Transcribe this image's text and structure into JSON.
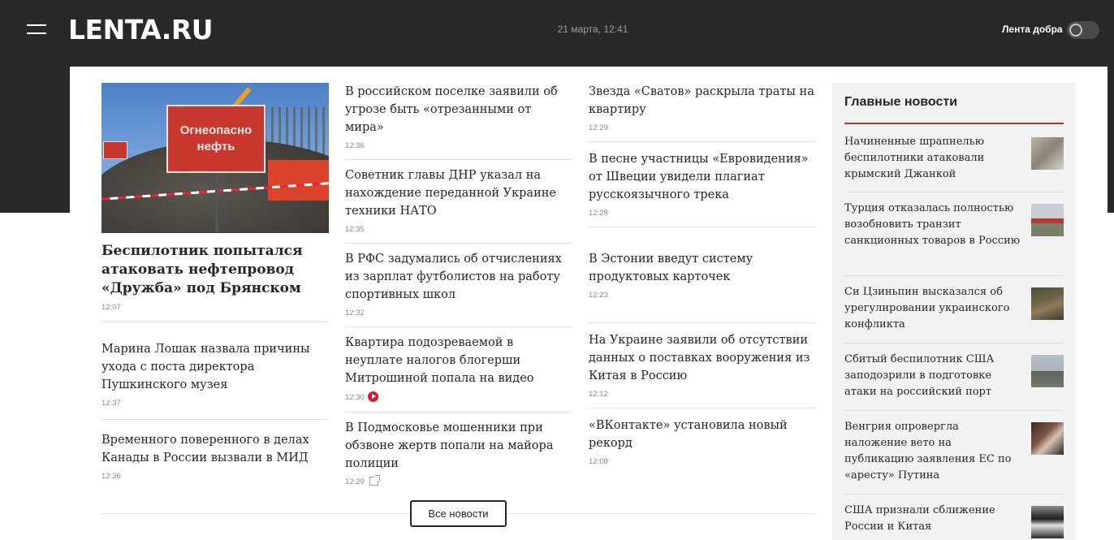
{
  "header": {
    "logo": "LENTA.RU",
    "datetime": "21 марта, 12:41",
    "good_news_label": "Лента добра"
  },
  "hero": {
    "sign_text": "Огнеопасно нефть",
    "title": "Беспилотник попытался атаковать нефтепровод «Дружба» под Брянском",
    "time": "12:07"
  },
  "col1": [
    {
      "title": "Марина Лошак назвала причины ухода с поста директора Пушкинского музея",
      "time": "12:37"
    },
    {
      "title": "Временного поверенного в делах Канады в России вызвали в МИД",
      "time": "12:36"
    }
  ],
  "col2": [
    {
      "title": "В российском поселке заявили об угрозе быть «отрезанными от мира»",
      "time": "12:36"
    },
    {
      "title": "Советник главы ДНР указал на нахождение переданной Украине техники НАТО",
      "time": "12:35"
    },
    {
      "title": "В РФС задумались об отчислениях из зарплат футболистов на работу спортивных школ",
      "time": "12:32"
    },
    {
      "title": "Квартира подозреваемой в неуплате налогов блогерши Митрошиной попала на видео",
      "time": "12:30"
    },
    {
      "title": "В Подмосковье мошенники при обзвоне жертв попали на майора полиции",
      "time": "12:29"
    }
  ],
  "col3": [
    {
      "title": "Звезда «Сватов» раскрыла траты на квартиру",
      "time": "12:29"
    },
    {
      "title": "В песне участницы «Евровидения» от Швеции увидели плагиат русскоязычного трека",
      "time": "12:28"
    },
    {
      "title": "В Эстонии введут систему продуктовых карточек",
      "time": "12:23"
    },
    {
      "title": "На Украине заявили об отсутствии данных о поставках вооружения из Китая в Россию",
      "time": "12:12"
    },
    {
      "title": "«ВКонтакте» установила новый рекорд",
      "time": "12:08"
    }
  ],
  "all_news_label": "Все новости",
  "sidebar": {
    "title": "Главные новости",
    "items": [
      {
        "title": "Начиненные шрапнелью беспилотники атаковали крымский Джанкой"
      },
      {
        "title": "Турция отказалась полностью возобновить транзит санкционных товаров в Россию"
      },
      {
        "title": "Си Цзиньпин высказался об урегулировании украинского конфликта"
      },
      {
        "title": "Сбитый беспилотник США заподозрили в подготовке атаки на российский порт"
      },
      {
        "title": "Венгрия опровергла наложение вето на публикацию заявления ЕС по «аресту» Путина"
      },
      {
        "title": "США признали сближение России и Китая"
      }
    ]
  },
  "colors": {
    "header_bg": "#292929",
    "accent_red": "#b03436",
    "video_red": "#d21f2f"
  }
}
